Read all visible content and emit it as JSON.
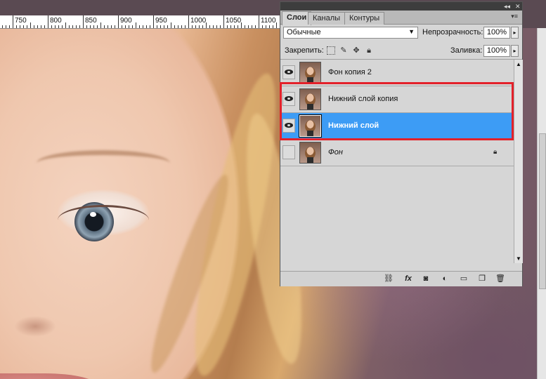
{
  "ruler": {
    "marks": [
      "750",
      "800",
      "850",
      "900",
      "950",
      "1000",
      "1050",
      "1100"
    ]
  },
  "panel": {
    "tabs": [
      {
        "label": "Слои",
        "active": true
      },
      {
        "label": "Каналы",
        "active": false
      },
      {
        "label": "Контуры",
        "active": false
      }
    ],
    "blend_mode": "Обычные",
    "opacity_label": "Непрозрачность:",
    "opacity_value": "100%",
    "lock_label": "Закрепить:",
    "fill_label": "Заливка:",
    "fill_value": "100%",
    "layers": [
      {
        "name": "Фон копия 2",
        "visible": true,
        "selected": false,
        "locked": false
      },
      {
        "name": "Нижний слой копия",
        "visible": true,
        "selected": false,
        "locked": false
      },
      {
        "name": "Нижний слой",
        "visible": true,
        "selected": true,
        "locked": false
      },
      {
        "name": "Фон",
        "visible": false,
        "selected": false,
        "locked": true
      }
    ],
    "bottom_icons": [
      "link-layers-icon",
      "fx-icon",
      "add-mask-icon",
      "adjustment-layer-icon",
      "new-group-icon",
      "new-layer-icon",
      "trash-icon"
    ],
    "fx_label": "fx"
  },
  "colors": {
    "selection": "#3d9cf5",
    "highlight": "#e3212a"
  }
}
